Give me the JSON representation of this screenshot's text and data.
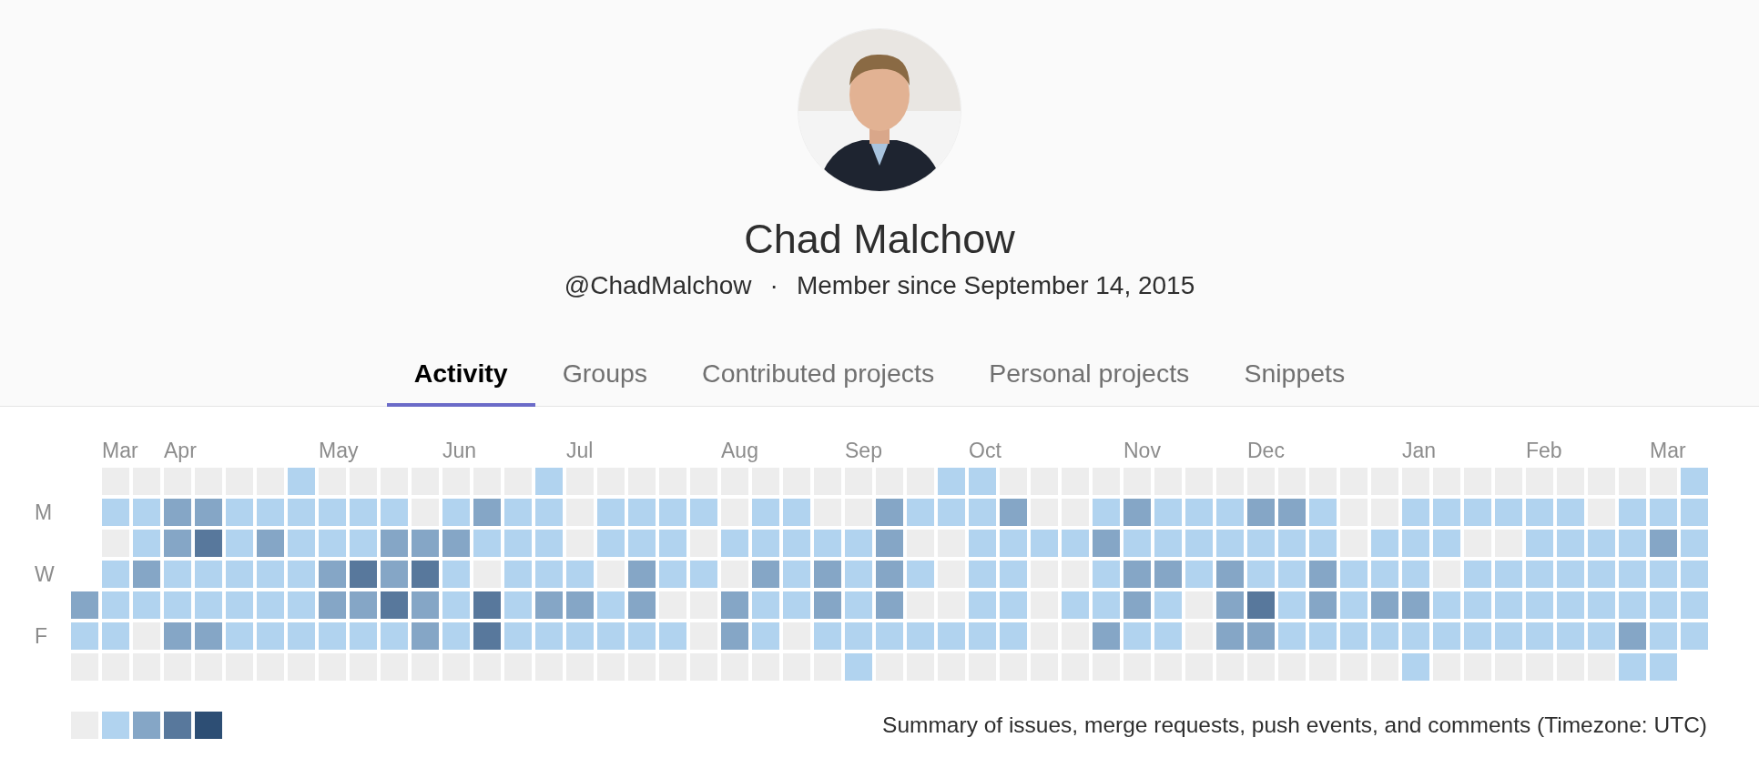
{
  "profile": {
    "name": "Chad Malchow",
    "username": "@ChadMalchow",
    "separator": "·",
    "member_since": "Member since September 14, 2015"
  },
  "tabs": [
    {
      "label": "Activity",
      "selected": true
    },
    {
      "label": "Groups",
      "selected": false
    },
    {
      "label": "Contributed projects",
      "selected": false
    },
    {
      "label": "Personal projects",
      "selected": false
    },
    {
      "label": "Snippets",
      "selected": false
    }
  ],
  "calendar": {
    "day_labels": [
      "M",
      "W",
      "F"
    ],
    "weeks": [
      {
        "days": [
          {
            "color": "#85a6c6"
          },
          {
            "color": "#b1d3ef"
          },
          {
            "color": "#ededed"
          }
        ]
      },
      {
        "month": "Mar",
        "days": [
          {
            "color": "#ededed"
          },
          {
            "color": "#b1d3ef"
          },
          {
            "color": "#ededed"
          },
          {
            "color": "#b1d3ef"
          },
          {
            "color": "#b1d3ef"
          },
          {
            "color": "#b1d3ef"
          },
          {
            "color": "#ededed"
          }
        ]
      },
      {
        "days": [
          {
            "color": "#ededed"
          },
          {
            "color": "#b1d3ef"
          },
          {
            "color": "#b1d3ef"
          },
          {
            "color": "#85a6c6"
          },
          {
            "color": "#b1d3ef"
          },
          {
            "color": "#ededed"
          },
          {
            "color": "#ededed"
          }
        ]
      },
      {
        "month": "Apr",
        "days": [
          {
            "color": "#ededed"
          },
          {
            "color": "#85a6c6"
          },
          {
            "color": "#85a6c6"
          },
          {
            "color": "#b1d3ef"
          },
          {
            "color": "#b1d3ef"
          },
          {
            "color": "#85a6c6"
          },
          {
            "color": "#ededed"
          }
        ]
      },
      {
        "days": [
          {
            "color": "#ededed"
          },
          {
            "color": "#85a6c6"
          },
          {
            "color": "#58789c"
          },
          {
            "color": "#b1d3ef"
          },
          {
            "color": "#b1d3ef"
          },
          {
            "color": "#85a6c6"
          },
          {
            "color": "#ededed"
          }
        ]
      },
      {
        "days": [
          {
            "color": "#ededed"
          },
          {
            "color": "#b1d3ef"
          },
          {
            "color": "#b1d3ef"
          },
          {
            "color": "#b1d3ef"
          },
          {
            "color": "#b1d3ef"
          },
          {
            "color": "#b1d3ef"
          },
          {
            "color": "#ededed"
          }
        ]
      },
      {
        "days": [
          {
            "color": "#ededed"
          },
          {
            "color": "#b1d3ef"
          },
          {
            "color": "#85a6c6"
          },
          {
            "color": "#b1d3ef"
          },
          {
            "color": "#b1d3ef"
          },
          {
            "color": "#b1d3ef"
          },
          {
            "color": "#ededed"
          }
        ]
      },
      {
        "days": [
          {
            "color": "#b1d3ef"
          },
          {
            "color": "#b1d3ef"
          },
          {
            "color": "#b1d3ef"
          },
          {
            "color": "#b1d3ef"
          },
          {
            "color": "#b1d3ef"
          },
          {
            "color": "#b1d3ef"
          },
          {
            "color": "#ededed"
          }
        ]
      },
      {
        "month": "May",
        "days": [
          {
            "color": "#ededed"
          },
          {
            "color": "#b1d3ef"
          },
          {
            "color": "#b1d3ef"
          },
          {
            "color": "#85a6c6"
          },
          {
            "color": "#85a6c6"
          },
          {
            "color": "#b1d3ef"
          },
          {
            "color": "#ededed"
          }
        ]
      },
      {
        "days": [
          {
            "color": "#ededed"
          },
          {
            "color": "#b1d3ef"
          },
          {
            "color": "#b1d3ef"
          },
          {
            "color": "#58789c"
          },
          {
            "color": "#85a6c6"
          },
          {
            "color": "#b1d3ef"
          },
          {
            "color": "#ededed"
          }
        ]
      },
      {
        "days": [
          {
            "color": "#ededed"
          },
          {
            "color": "#b1d3ef"
          },
          {
            "color": "#85a6c6"
          },
          {
            "color": "#85a6c6"
          },
          {
            "color": "#58789c"
          },
          {
            "color": "#b1d3ef"
          },
          {
            "color": "#ededed"
          }
        ]
      },
      {
        "days": [
          {
            "color": "#ededed"
          },
          {
            "color": "#ededed"
          },
          {
            "color": "#85a6c6"
          },
          {
            "color": "#58789c"
          },
          {
            "color": "#85a6c6"
          },
          {
            "color": "#85a6c6"
          },
          {
            "color": "#ededed"
          }
        ]
      },
      {
        "month": "Jun",
        "days": [
          {
            "color": "#ededed"
          },
          {
            "color": "#b1d3ef"
          },
          {
            "color": "#85a6c6"
          },
          {
            "color": "#b1d3ef"
          },
          {
            "color": "#b1d3ef"
          },
          {
            "color": "#b1d3ef"
          },
          {
            "color": "#ededed"
          }
        ]
      },
      {
        "days": [
          {
            "color": "#ededed"
          },
          {
            "color": "#85a6c6"
          },
          {
            "color": "#b1d3ef"
          },
          {
            "color": "#ededed"
          },
          {
            "color": "#58789c"
          },
          {
            "color": "#58789c"
          },
          {
            "color": "#ededed"
          }
        ]
      },
      {
        "days": [
          {
            "color": "#ededed"
          },
          {
            "color": "#b1d3ef"
          },
          {
            "color": "#b1d3ef"
          },
          {
            "color": "#b1d3ef"
          },
          {
            "color": "#b1d3ef"
          },
          {
            "color": "#b1d3ef"
          },
          {
            "color": "#ededed"
          }
        ]
      },
      {
        "days": [
          {
            "color": "#b1d3ef"
          },
          {
            "color": "#b1d3ef"
          },
          {
            "color": "#b1d3ef"
          },
          {
            "color": "#b1d3ef"
          },
          {
            "color": "#85a6c6"
          },
          {
            "color": "#b1d3ef"
          },
          {
            "color": "#ededed"
          }
        ]
      },
      {
        "month": "Jul",
        "days": [
          {
            "color": "#ededed"
          },
          {
            "color": "#ededed"
          },
          {
            "color": "#ededed"
          },
          {
            "color": "#b1d3ef"
          },
          {
            "color": "#85a6c6"
          },
          {
            "color": "#b1d3ef"
          },
          {
            "color": "#ededed"
          }
        ]
      },
      {
        "days": [
          {
            "color": "#ededed"
          },
          {
            "color": "#b1d3ef"
          },
          {
            "color": "#b1d3ef"
          },
          {
            "color": "#ededed"
          },
          {
            "color": "#b1d3ef"
          },
          {
            "color": "#b1d3ef"
          },
          {
            "color": "#ededed"
          }
        ]
      },
      {
        "days": [
          {
            "color": "#ededed"
          },
          {
            "color": "#b1d3ef"
          },
          {
            "color": "#b1d3ef"
          },
          {
            "color": "#85a6c6"
          },
          {
            "color": "#85a6c6"
          },
          {
            "color": "#b1d3ef"
          },
          {
            "color": "#ededed"
          }
        ]
      },
      {
        "days": [
          {
            "color": "#ededed"
          },
          {
            "color": "#b1d3ef"
          },
          {
            "color": "#b1d3ef"
          },
          {
            "color": "#b1d3ef"
          },
          {
            "color": "#ededed"
          },
          {
            "color": "#b1d3ef"
          },
          {
            "color": "#ededed"
          }
        ]
      },
      {
        "days": [
          {
            "color": "#ededed"
          },
          {
            "color": "#b1d3ef"
          },
          {
            "color": "#ededed"
          },
          {
            "color": "#b1d3ef"
          },
          {
            "color": "#ededed"
          },
          {
            "color": "#ededed"
          },
          {
            "color": "#ededed"
          }
        ]
      },
      {
        "month": "Aug",
        "days": [
          {
            "color": "#ededed"
          },
          {
            "color": "#ededed"
          },
          {
            "color": "#b1d3ef"
          },
          {
            "color": "#ededed"
          },
          {
            "color": "#85a6c6"
          },
          {
            "color": "#85a6c6"
          },
          {
            "color": "#ededed"
          }
        ]
      },
      {
        "days": [
          {
            "color": "#ededed"
          },
          {
            "color": "#b1d3ef"
          },
          {
            "color": "#b1d3ef"
          },
          {
            "color": "#85a6c6"
          },
          {
            "color": "#b1d3ef"
          },
          {
            "color": "#b1d3ef"
          },
          {
            "color": "#ededed"
          }
        ]
      },
      {
        "days": [
          {
            "color": "#ededed"
          },
          {
            "color": "#b1d3ef"
          },
          {
            "color": "#b1d3ef"
          },
          {
            "color": "#b1d3ef"
          },
          {
            "color": "#b1d3ef"
          },
          {
            "color": "#ededed"
          },
          {
            "color": "#ededed"
          }
        ]
      },
      {
        "days": [
          {
            "color": "#ededed"
          },
          {
            "color": "#ededed"
          },
          {
            "color": "#b1d3ef"
          },
          {
            "color": "#85a6c6"
          },
          {
            "color": "#85a6c6"
          },
          {
            "color": "#b1d3ef"
          },
          {
            "color": "#ededed"
          }
        ]
      },
      {
        "month": "Sep",
        "days": [
          {
            "color": "#ededed"
          },
          {
            "color": "#ededed"
          },
          {
            "color": "#b1d3ef"
          },
          {
            "color": "#b1d3ef"
          },
          {
            "color": "#b1d3ef"
          },
          {
            "color": "#b1d3ef"
          },
          {
            "color": "#b1d3ef"
          }
        ]
      },
      {
        "days": [
          {
            "color": "#ededed"
          },
          {
            "color": "#85a6c6"
          },
          {
            "color": "#85a6c6"
          },
          {
            "color": "#85a6c6"
          },
          {
            "color": "#85a6c6"
          },
          {
            "color": "#b1d3ef"
          },
          {
            "color": "#ededed"
          }
        ]
      },
      {
        "days": [
          {
            "color": "#ededed"
          },
          {
            "color": "#b1d3ef"
          },
          {
            "color": "#ededed"
          },
          {
            "color": "#b1d3ef"
          },
          {
            "color": "#ededed"
          },
          {
            "color": "#b1d3ef"
          },
          {
            "color": "#ededed"
          }
        ]
      },
      {
        "days": [
          {
            "color": "#b1d3ef"
          },
          {
            "color": "#b1d3ef"
          },
          {
            "color": "#ededed"
          },
          {
            "color": "#ededed"
          },
          {
            "color": "#ededed"
          },
          {
            "color": "#b1d3ef"
          },
          {
            "color": "#ededed"
          }
        ]
      },
      {
        "month": "Oct",
        "days": [
          {
            "color": "#b1d3ef"
          },
          {
            "color": "#b1d3ef"
          },
          {
            "color": "#b1d3ef"
          },
          {
            "color": "#b1d3ef"
          },
          {
            "color": "#b1d3ef"
          },
          {
            "color": "#b1d3ef"
          },
          {
            "color": "#ededed"
          }
        ]
      },
      {
        "days": [
          {
            "color": "#ededed"
          },
          {
            "color": "#85a6c6"
          },
          {
            "color": "#b1d3ef"
          },
          {
            "color": "#b1d3ef"
          },
          {
            "color": "#b1d3ef"
          },
          {
            "color": "#b1d3ef"
          },
          {
            "color": "#ededed"
          }
        ]
      },
      {
        "days": [
          {
            "color": "#ededed"
          },
          {
            "color": "#ededed"
          },
          {
            "color": "#b1d3ef"
          },
          {
            "color": "#ededed"
          },
          {
            "color": "#ededed"
          },
          {
            "color": "#ededed"
          },
          {
            "color": "#ededed"
          }
        ]
      },
      {
        "days": [
          {
            "color": "#ededed"
          },
          {
            "color": "#ededed"
          },
          {
            "color": "#b1d3ef"
          },
          {
            "color": "#ededed"
          },
          {
            "color": "#b1d3ef"
          },
          {
            "color": "#ededed"
          },
          {
            "color": "#ededed"
          }
        ]
      },
      {
        "days": [
          {
            "color": "#ededed"
          },
          {
            "color": "#b1d3ef"
          },
          {
            "color": "#85a6c6"
          },
          {
            "color": "#b1d3ef"
          },
          {
            "color": "#b1d3ef"
          },
          {
            "color": "#85a6c6"
          },
          {
            "color": "#ededed"
          }
        ]
      },
      {
        "month": "Nov",
        "days": [
          {
            "color": "#ededed"
          },
          {
            "color": "#85a6c6"
          },
          {
            "color": "#b1d3ef"
          },
          {
            "color": "#85a6c6"
          },
          {
            "color": "#85a6c6"
          },
          {
            "color": "#b1d3ef"
          },
          {
            "color": "#ededed"
          }
        ]
      },
      {
        "days": [
          {
            "color": "#ededed"
          },
          {
            "color": "#b1d3ef"
          },
          {
            "color": "#b1d3ef"
          },
          {
            "color": "#85a6c6"
          },
          {
            "color": "#b1d3ef"
          },
          {
            "color": "#b1d3ef"
          },
          {
            "color": "#ededed"
          }
        ]
      },
      {
        "days": [
          {
            "color": "#ededed"
          },
          {
            "color": "#b1d3ef"
          },
          {
            "color": "#b1d3ef"
          },
          {
            "color": "#b1d3ef"
          },
          {
            "color": "#ededed"
          },
          {
            "color": "#ededed"
          },
          {
            "color": "#ededed"
          }
        ]
      },
      {
        "days": [
          {
            "color": "#ededed"
          },
          {
            "color": "#b1d3ef"
          },
          {
            "color": "#b1d3ef"
          },
          {
            "color": "#85a6c6"
          },
          {
            "color": "#85a6c6"
          },
          {
            "color": "#85a6c6"
          },
          {
            "color": "#ededed"
          }
        ]
      },
      {
        "month": "Dec",
        "days": [
          {
            "color": "#ededed"
          },
          {
            "color": "#85a6c6"
          },
          {
            "color": "#b1d3ef"
          },
          {
            "color": "#b1d3ef"
          },
          {
            "color": "#58789c"
          },
          {
            "color": "#85a6c6"
          },
          {
            "color": "#ededed"
          }
        ]
      },
      {
        "days": [
          {
            "color": "#ededed"
          },
          {
            "color": "#85a6c6"
          },
          {
            "color": "#b1d3ef"
          },
          {
            "color": "#b1d3ef"
          },
          {
            "color": "#b1d3ef"
          },
          {
            "color": "#b1d3ef"
          },
          {
            "color": "#ededed"
          }
        ]
      },
      {
        "days": [
          {
            "color": "#ededed"
          },
          {
            "color": "#b1d3ef"
          },
          {
            "color": "#b1d3ef"
          },
          {
            "color": "#85a6c6"
          },
          {
            "color": "#85a6c6"
          },
          {
            "color": "#b1d3ef"
          },
          {
            "color": "#ededed"
          }
        ]
      },
      {
        "days": [
          {
            "color": "#ededed"
          },
          {
            "color": "#ededed"
          },
          {
            "color": "#ededed"
          },
          {
            "color": "#b1d3ef"
          },
          {
            "color": "#b1d3ef"
          },
          {
            "color": "#b1d3ef"
          },
          {
            "color": "#ededed"
          }
        ]
      },
      {
        "days": [
          {
            "color": "#ededed"
          },
          {
            "color": "#ededed"
          },
          {
            "color": "#b1d3ef"
          },
          {
            "color": "#b1d3ef"
          },
          {
            "color": "#85a6c6"
          },
          {
            "color": "#b1d3ef"
          },
          {
            "color": "#ededed"
          }
        ]
      },
      {
        "month": "Jan",
        "days": [
          {
            "color": "#ededed"
          },
          {
            "color": "#b1d3ef"
          },
          {
            "color": "#b1d3ef"
          },
          {
            "color": "#b1d3ef"
          },
          {
            "color": "#85a6c6"
          },
          {
            "color": "#b1d3ef"
          },
          {
            "color": "#b1d3ef"
          }
        ]
      },
      {
        "days": [
          {
            "color": "#ededed"
          },
          {
            "color": "#b1d3ef"
          },
          {
            "color": "#b1d3ef"
          },
          {
            "color": "#ededed"
          },
          {
            "color": "#b1d3ef"
          },
          {
            "color": "#b1d3ef"
          },
          {
            "color": "#ededed"
          }
        ]
      },
      {
        "days": [
          {
            "color": "#ededed"
          },
          {
            "color": "#b1d3ef"
          },
          {
            "color": "#ededed"
          },
          {
            "color": "#b1d3ef"
          },
          {
            "color": "#b1d3ef"
          },
          {
            "color": "#b1d3ef"
          },
          {
            "color": "#ededed"
          }
        ]
      },
      {
        "days": [
          {
            "color": "#ededed"
          },
          {
            "color": "#b1d3ef"
          },
          {
            "color": "#ededed"
          },
          {
            "color": "#b1d3ef"
          },
          {
            "color": "#b1d3ef"
          },
          {
            "color": "#b1d3ef"
          },
          {
            "color": "#ededed"
          }
        ]
      },
      {
        "month": "Feb",
        "days": [
          {
            "color": "#ededed"
          },
          {
            "color": "#b1d3ef"
          },
          {
            "color": "#b1d3ef"
          },
          {
            "color": "#b1d3ef"
          },
          {
            "color": "#b1d3ef"
          },
          {
            "color": "#b1d3ef"
          },
          {
            "color": "#ededed"
          }
        ]
      },
      {
        "days": [
          {
            "color": "#ededed"
          },
          {
            "color": "#b1d3ef"
          },
          {
            "color": "#b1d3ef"
          },
          {
            "color": "#b1d3ef"
          },
          {
            "color": "#b1d3ef"
          },
          {
            "color": "#b1d3ef"
          },
          {
            "color": "#ededed"
          }
        ]
      },
      {
        "days": [
          {
            "color": "#ededed"
          },
          {
            "color": "#ededed"
          },
          {
            "color": "#b1d3ef"
          },
          {
            "color": "#b1d3ef"
          },
          {
            "color": "#b1d3ef"
          },
          {
            "color": "#b1d3ef"
          },
          {
            "color": "#ededed"
          }
        ]
      },
      {
        "days": [
          {
            "color": "#ededed"
          },
          {
            "color": "#b1d3ef"
          },
          {
            "color": "#b1d3ef"
          },
          {
            "color": "#b1d3ef"
          },
          {
            "color": "#b1d3ef"
          },
          {
            "color": "#85a6c6"
          },
          {
            "color": "#b1d3ef"
          }
        ]
      },
      {
        "month": "Mar",
        "days": [
          {
            "color": "#ededed"
          },
          {
            "color": "#b1d3ef"
          },
          {
            "color": "#85a6c6"
          },
          {
            "color": "#b1d3ef"
          },
          {
            "color": "#b1d3ef"
          },
          {
            "color": "#b1d3ef"
          },
          {
            "color": "#b1d3ef"
          }
        ]
      },
      {
        "days": [
          {
            "color": "#b1d3ef"
          },
          {
            "color": "#b1d3ef"
          },
          {
            "color": "#b1d3ef"
          },
          {
            "color": "#b1d3ef"
          },
          {
            "color": "#b1d3ef"
          },
          {
            "color": "#b1d3ef"
          }
        ]
      }
    ],
    "legend": [
      {
        "color": "#ededed"
      },
      {
        "color": "#b1d3ef"
      },
      {
        "color": "#85a6c6"
      },
      {
        "color": "#58789c"
      },
      {
        "color": "#2d4e74"
      }
    ],
    "summary": "Summary of issues, merge requests, push events, and comments (Timezone: UTC)"
  }
}
